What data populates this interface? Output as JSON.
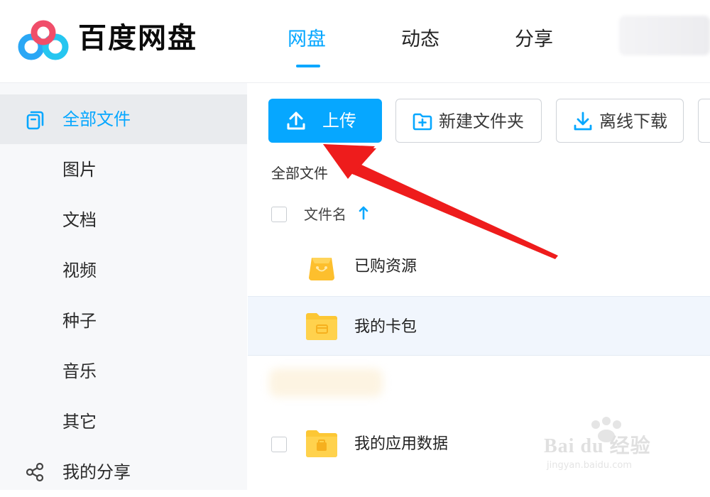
{
  "app": {
    "logo_text": "百度网盘",
    "accent_color": "#06a7ff"
  },
  "nav": {
    "tabs": [
      {
        "label": "网盘",
        "active": true
      },
      {
        "label": "动态",
        "active": false
      },
      {
        "label": "分享",
        "active": false
      }
    ]
  },
  "sidebar": {
    "items": [
      {
        "label": "全部文件",
        "icon": "all-files-icon",
        "active": true
      },
      {
        "label": "图片"
      },
      {
        "label": "文档"
      },
      {
        "label": "视频"
      },
      {
        "label": "种子"
      },
      {
        "label": "音乐"
      },
      {
        "label": "其它"
      },
      {
        "label": "我的分享",
        "icon": "share-icon"
      }
    ]
  },
  "toolbar": {
    "upload_label": "上传",
    "new_folder_label": "新建文件夹",
    "offline_download_label": "离线下载"
  },
  "breadcrumb": "全部文件",
  "file_list": {
    "column_name": "文件名",
    "sort": "ascending",
    "rows": [
      {
        "name": "已购资源",
        "icon": "purchased-bag-icon",
        "checkbox": false
      },
      {
        "name": "我的卡包",
        "icon": "folder-wallet-icon",
        "checkbox": false,
        "highlighted": true
      },
      {
        "name": "我的应用数据",
        "icon": "folder-app-data-icon",
        "checkbox": true
      }
    ]
  },
  "watermark": {
    "text": "Bai du 经验",
    "sub": "jingyan.baidu.com"
  },
  "annotation": {
    "arrow_color": "#ee1c1c"
  }
}
